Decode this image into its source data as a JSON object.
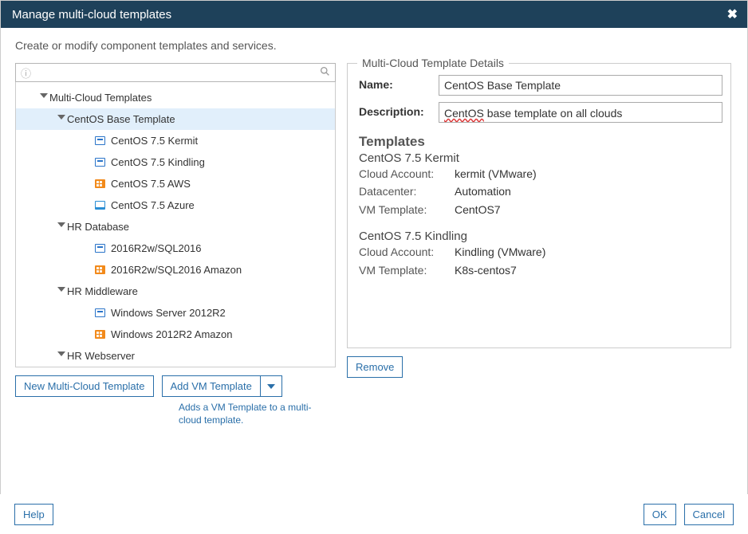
{
  "title": "Manage multi-cloud templates",
  "subtitle": "Create or modify component templates and services.",
  "search": {
    "placeholder": ""
  },
  "tree": {
    "root_label": "Multi-Cloud Templates",
    "groups": [
      {
        "label": "CentOS Base Template",
        "selected": true,
        "children": [
          {
            "label": "CentOS 7.5 Kermit",
            "icon": "blue"
          },
          {
            "label": "CentOS 7.5 Kindling",
            "icon": "blue"
          },
          {
            "label": "CentOS 7.5 AWS",
            "icon": "orange"
          },
          {
            "label": "CentOS 7.5 Azure",
            "icon": "azure"
          }
        ]
      },
      {
        "label": "HR Database",
        "children": [
          {
            "label": "2016R2w/SQL2016",
            "icon": "blue"
          },
          {
            "label": "2016R2w/SQL2016 Amazon",
            "icon": "orange"
          }
        ]
      },
      {
        "label": "HR Middleware",
        "children": [
          {
            "label": "Windows Server 2012R2",
            "icon": "blue"
          },
          {
            "label": "Windows 2012R2 Amazon",
            "icon": "orange"
          }
        ]
      },
      {
        "label": "HR Webserver",
        "children": []
      }
    ]
  },
  "buttons": {
    "new_template": "New Multi-Cloud Template",
    "add_vm_template": "Add VM Template",
    "add_vm_hint": "Adds a VM Template to a multi-cloud template.",
    "remove": "Remove",
    "help": "Help",
    "ok": "OK",
    "cancel": "Cancel"
  },
  "details": {
    "legend": "Multi-Cloud Template Details",
    "name_label": "Name:",
    "name_value": "CentOS Base Template",
    "desc_label": "Description:",
    "desc_word": "CentOS",
    "desc_rest": " base template on all clouds",
    "templates_heading": "Templates",
    "templates": [
      {
        "name": "CentOS 7.5 Kermit",
        "rows": [
          {
            "k": "Cloud Account:",
            "v": "kermit (VMware)"
          },
          {
            "k": "Datacenter:",
            "v": "Automation"
          },
          {
            "k": "VM Template:",
            "v": "CentOS7"
          }
        ]
      },
      {
        "name": "CentOS 7.5 Kindling",
        "rows": [
          {
            "k": "Cloud Account:",
            "v": "Kindling (VMware)"
          },
          {
            "k": "VM Template:",
            "v": "K8s-centos7"
          }
        ]
      }
    ]
  }
}
